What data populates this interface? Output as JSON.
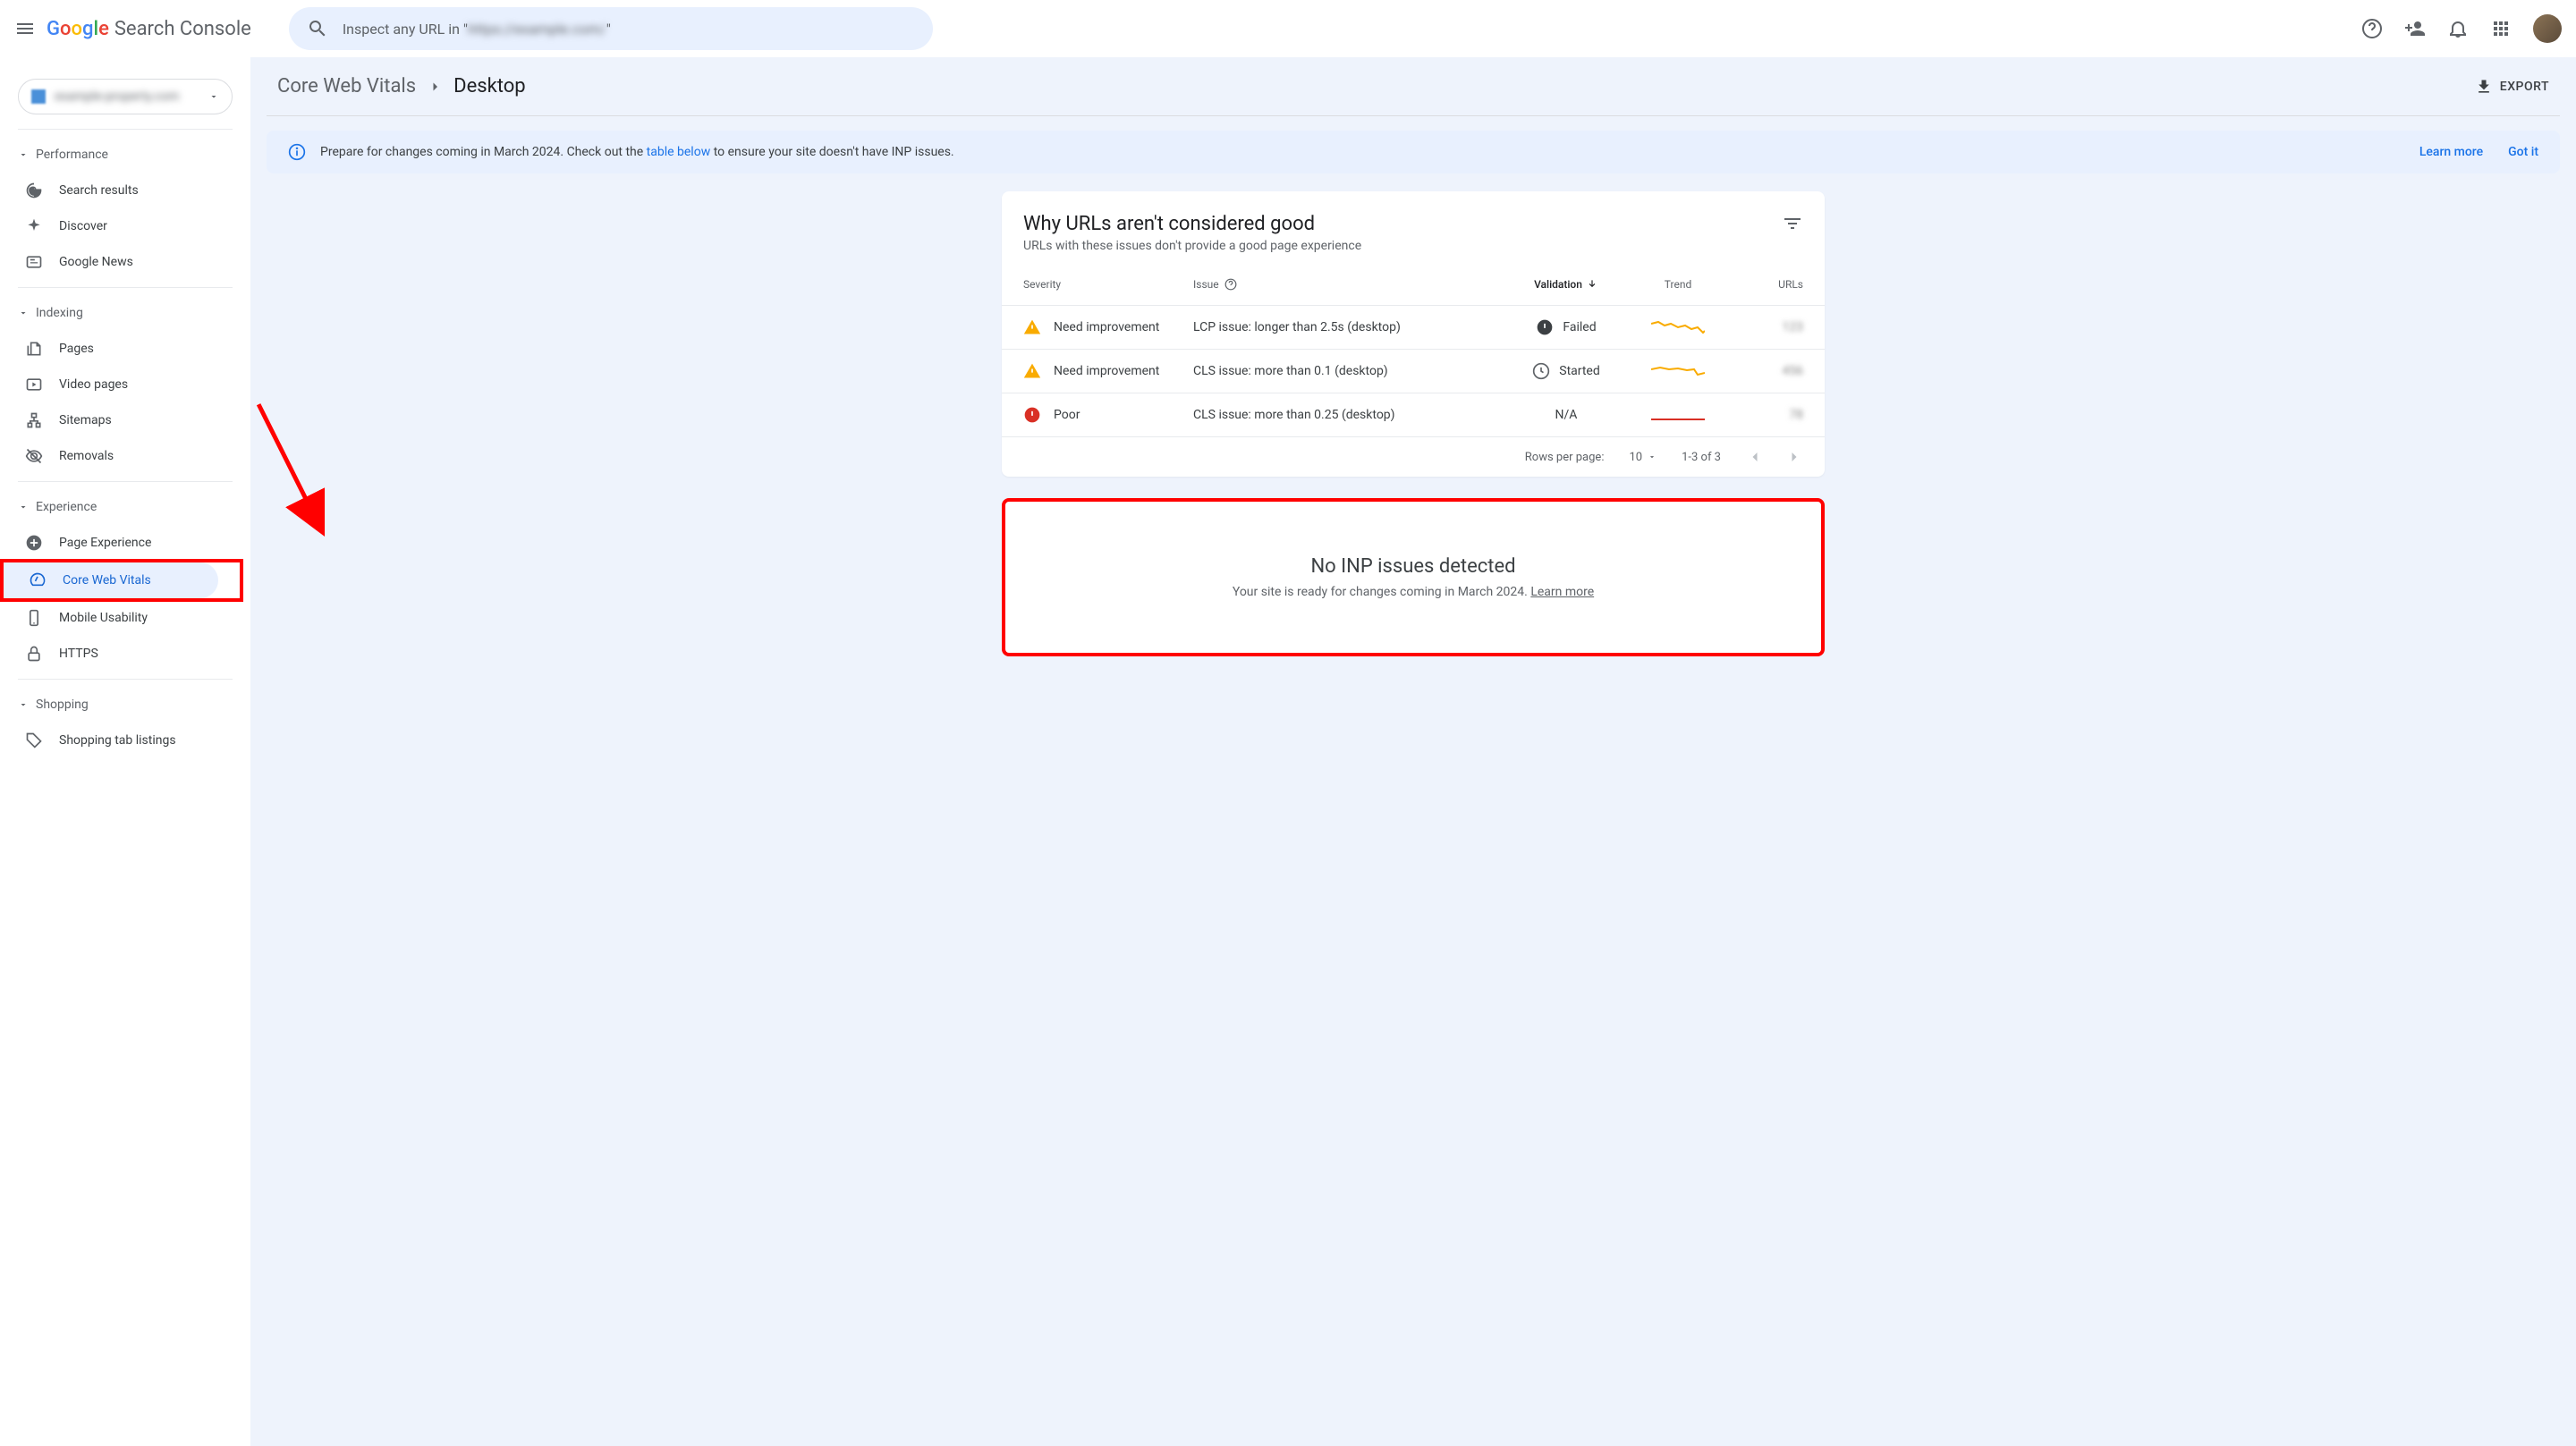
{
  "header": {
    "product_name": "Search Console",
    "search_placeholder_prefix": "Inspect any URL in \"",
    "search_placeholder_blurred": "https://example.com/",
    "search_placeholder_suffix": "\""
  },
  "sidebar": {
    "property_name": "example-property.com",
    "sections": [
      {
        "label": "Performance",
        "items": [
          {
            "icon": "google-g",
            "label": "Search results"
          },
          {
            "icon": "discover",
            "label": "Discover"
          },
          {
            "icon": "news",
            "label": "Google News"
          }
        ]
      },
      {
        "label": "Indexing",
        "items": [
          {
            "icon": "pages",
            "label": "Pages"
          },
          {
            "icon": "video",
            "label": "Video pages"
          },
          {
            "icon": "sitemap",
            "label": "Sitemaps"
          },
          {
            "icon": "removals",
            "label": "Removals"
          }
        ]
      },
      {
        "label": "Experience",
        "items": [
          {
            "icon": "plus-circle",
            "label": "Page Experience"
          },
          {
            "icon": "speed",
            "label": "Core Web Vitals",
            "active": true
          },
          {
            "icon": "mobile",
            "label": "Mobile Usability"
          },
          {
            "icon": "lock",
            "label": "HTTPS"
          }
        ]
      },
      {
        "label": "Shopping",
        "items": [
          {
            "icon": "tag",
            "label": "Shopping tab listings"
          }
        ]
      }
    ]
  },
  "breadcrumb": {
    "parent": "Core Web Vitals",
    "current": "Desktop"
  },
  "export_label": "EXPORT",
  "banner": {
    "text_before": "Prepare for changes coming in March 2024. Check out the ",
    "link_text": "table below",
    "text_after": " to ensure your site doesn't have INP issues.",
    "learn_more": "Learn more",
    "got_it": "Got it"
  },
  "issues_card": {
    "title": "Why URLs aren't considered good",
    "subtitle": "URLs with these issues don't provide a good page experience",
    "columns": {
      "severity": "Severity",
      "issue": "Issue",
      "validation": "Validation",
      "trend": "Trend",
      "urls": "URLs"
    },
    "rows": [
      {
        "severity": "Need improvement",
        "severity_level": "warning",
        "issue": "LCP issue: longer than 2.5s (desktop)",
        "validation": "Failed",
        "validation_icon": "failed",
        "trend_color": "#f9ab00",
        "urls": "123"
      },
      {
        "severity": "Need improvement",
        "severity_level": "warning",
        "issue": "CLS issue: more than 0.1 (desktop)",
        "validation": "Started",
        "validation_icon": "started",
        "trend_color": "#f9ab00",
        "urls": "456"
      },
      {
        "severity": "Poor",
        "severity_level": "error",
        "issue": "CLS issue: more than 0.25 (desktop)",
        "validation": "N/A",
        "validation_icon": "none",
        "trend_color": "#d93025",
        "urls": "78"
      }
    ],
    "pagination": {
      "rows_label": "Rows per page:",
      "rows_value": "10",
      "range": "1-3 of 3"
    }
  },
  "inp_card": {
    "title": "No INP issues detected",
    "subtitle_before": "Your site is ready for changes coming in March 2024. ",
    "learn_more": "Learn more"
  }
}
